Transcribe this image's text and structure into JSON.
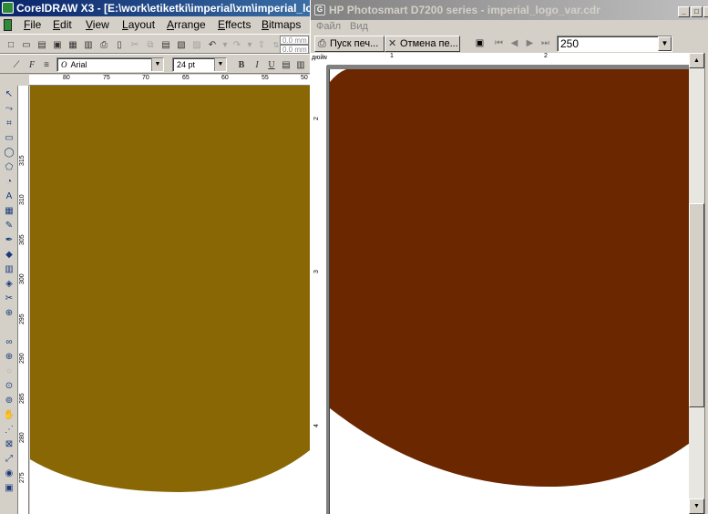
{
  "corel": {
    "title": "CorelDRAW X3 - [E:\\work\\etiketki\\imperial\\xm\\imperial_logo_var.cdr]",
    "menu": [
      {
        "mnem": "F",
        "rest": "ile"
      },
      {
        "mnem": "E",
        "rest": "dit"
      },
      {
        "mnem": "V",
        "rest": "iew"
      },
      {
        "mnem": "L",
        "rest": "ayout"
      },
      {
        "mnem": "A",
        "rest": "rrange"
      },
      {
        "mnem": "E",
        "rest": "ffects"
      },
      {
        "mnem": "B",
        "rest": "itmaps"
      }
    ],
    "nudge_x": "0.0 mm",
    "nudge_y": "0.0 mm",
    "font_name": "Arial",
    "font_size": "24 pt",
    "bold_label": "B",
    "italic_label": "I",
    "underline_label": "U",
    "hruler_ticks": [
      "80",
      "75",
      "70",
      "65",
      "60",
      "55",
      "50"
    ],
    "vruler_ticks": [
      "315",
      "310",
      "305",
      "300",
      "295",
      "290",
      "285",
      "280",
      "275"
    ],
    "shape_color": "#896704"
  },
  "hp": {
    "title": "HP Photosmart D7200 series - imperial_logo_var.cdr",
    "menu": [
      "Файл",
      "Вид"
    ],
    "print_button": "Пуск печ...",
    "cancel_button": "Отмена пе...",
    "zoom": "250",
    "unit_label": "дюйм",
    "hruler_ticks": [
      "1",
      "2"
    ],
    "vruler_ticks": [
      "2",
      "3",
      "4"
    ],
    "shape_color": "#6b2700"
  }
}
